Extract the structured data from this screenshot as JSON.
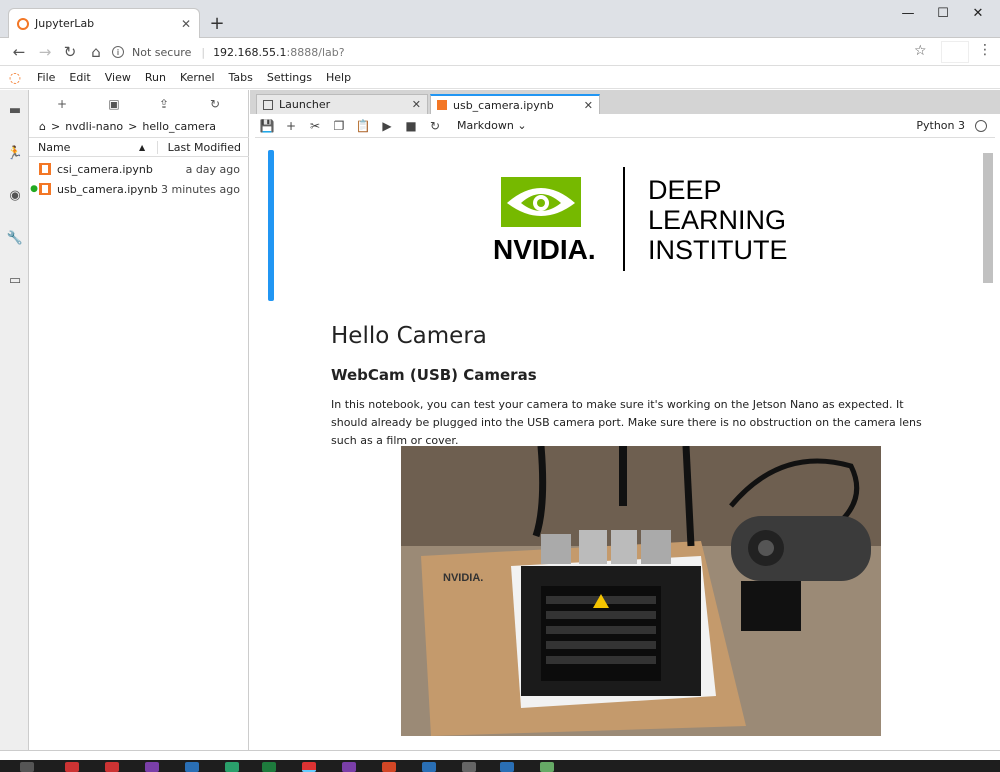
{
  "browser": {
    "tab_title": "JupyterLab",
    "new_tab": "+",
    "security": "Not secure",
    "url_host": "192.168.55.1",
    "url_path": ":8888/lab?"
  },
  "menu": {
    "items": [
      "File",
      "Edit",
      "View",
      "Run",
      "Kernel",
      "Tabs",
      "Settings",
      "Help"
    ]
  },
  "filebrowser": {
    "breadcrumb": [
      "nvdli-nano",
      ">",
      "hello_camera"
    ],
    "col_name": "Name",
    "col_modified": "Last Modified",
    "files": [
      {
        "name": "csi_camera.ipynb",
        "modified": "a day ago",
        "running": false
      },
      {
        "name": "usb_camera.ipynb",
        "modified": "3 minutes ago",
        "running": true
      }
    ]
  },
  "tabs": [
    {
      "label": "Launcher"
    },
    {
      "label": "usb_camera.ipynb"
    }
  ],
  "toolbar": {
    "cell_type": "Markdown",
    "kernel": "Python 3"
  },
  "notebook": {
    "logo_brand": "NVIDIA.",
    "logo_line1": "DEEP",
    "logo_line2": "LEARNING",
    "logo_line3": "INSTITUTE",
    "heading": "Hello Camera",
    "subheading": "WebCam (USB) Cameras",
    "paragraph": "In this notebook, you can test your camera to make sure it's working on the Jetson Nano as expected. It should already be plugged into the USB camera port. Make sure there is no obstruction on the camera lens such as a film or cover."
  },
  "colors": {
    "accent": "#2196f3",
    "nvidia_green": "#76b900",
    "jupyter_orange": "#f37726"
  }
}
